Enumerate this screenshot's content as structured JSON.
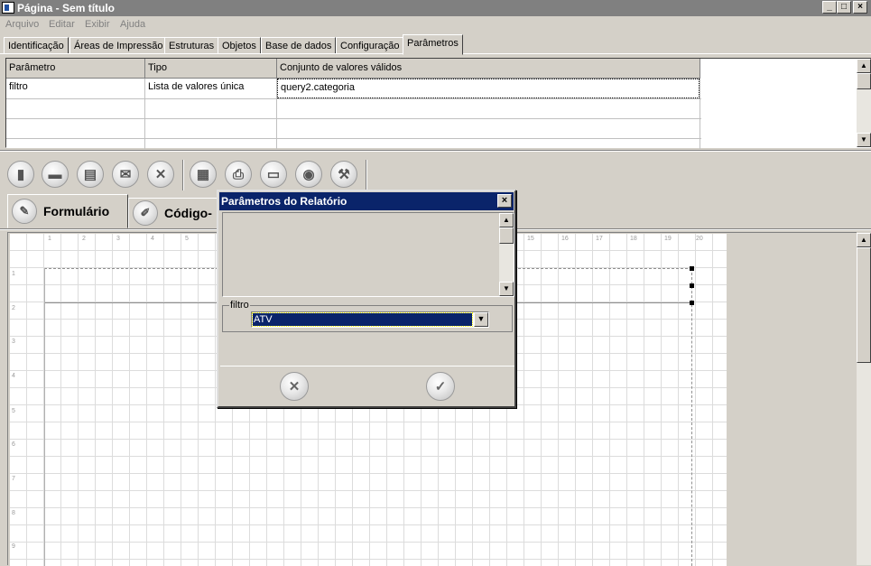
{
  "window": {
    "title": "Página - Sem título",
    "minimize": "_",
    "maximize": "□",
    "close": "×"
  },
  "menu": [
    "Arquivo",
    "Editar",
    "Exibir",
    "Ajuda"
  ],
  "tabs": [
    "Identificação",
    "Áreas de Impressão",
    "Estruturas",
    "Objetos",
    "Base de dados",
    "Configuração",
    "Parâmetros"
  ],
  "active_tab": "Parâmetros",
  "param_table": {
    "columns": [
      "Parâmetro",
      "Tipo",
      "Conjunto de valores válidos"
    ],
    "rows": [
      [
        "filtro",
        "Lista de valores única",
        "query2.categoria"
      ]
    ]
  },
  "toolbar": {
    "icons": [
      "new-document-icon",
      "open-folder-icon",
      "save-icon",
      "email-icon",
      "cancel-icon",
      "report-icon",
      "print-icon",
      "monitor-icon",
      "globe-icon",
      "hammer-icon"
    ],
    "glyphs": [
      "▮",
      "▬",
      "▤",
      "✉",
      "✕",
      "▦",
      "⎙",
      "▭",
      "◉",
      "⚒"
    ]
  },
  "mode_tabs": [
    {
      "label": "Formulário",
      "icon": "edit-form-icon",
      "glyph": "✎"
    },
    {
      "label": "Código-",
      "icon": "pencil-icon",
      "glyph": "✐"
    }
  ],
  "ruler": [
    "1",
    "2",
    "3",
    "4",
    "5",
    "15",
    "16",
    "17",
    "18",
    "19",
    "20"
  ],
  "ruler_v": [
    "1",
    "2",
    "3",
    "4",
    "5",
    "6",
    "7",
    "8",
    "9"
  ],
  "dialog": {
    "title": "Parâmetros do Relatório",
    "close": "×",
    "group_label": "filtro",
    "combo_value": "ATV",
    "cancel_glyph": "✕",
    "ok_glyph": "✓"
  }
}
